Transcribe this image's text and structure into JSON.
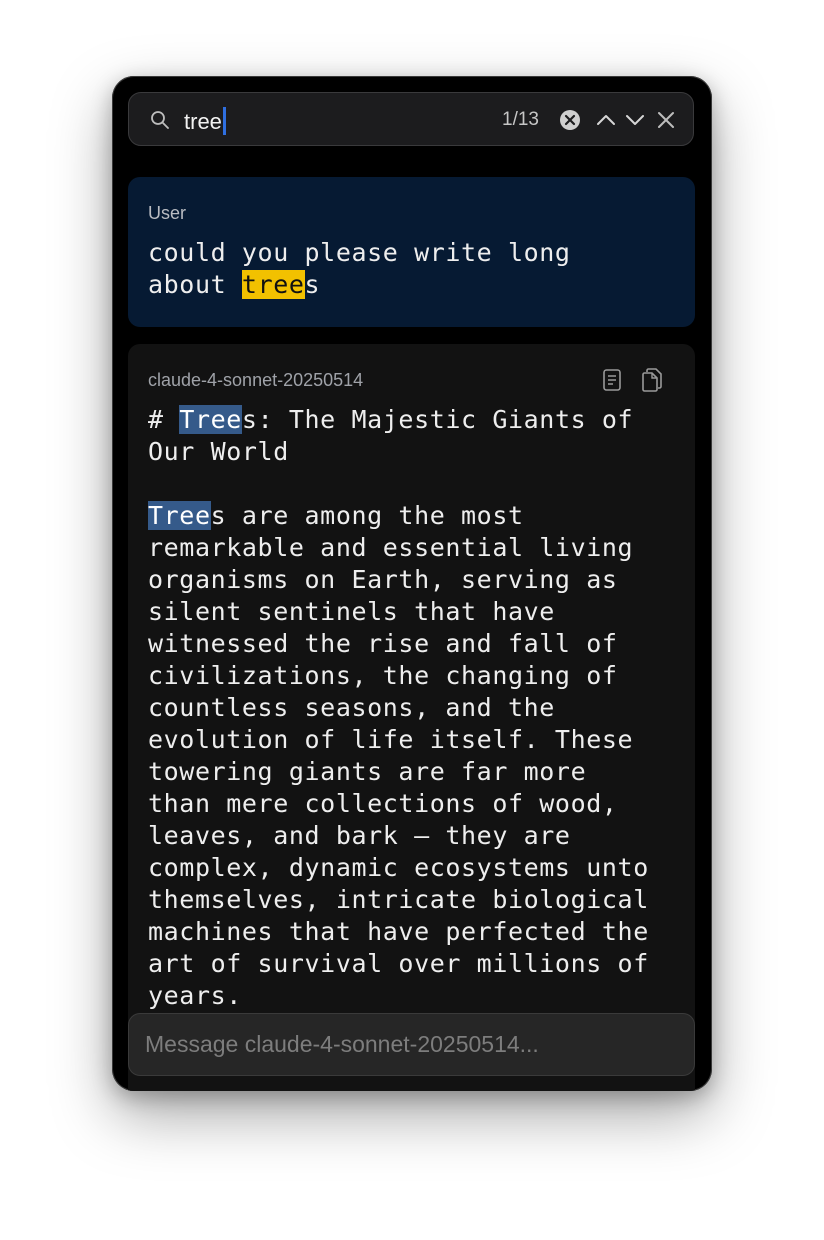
{
  "search": {
    "query": "tree",
    "match_count": "1/13"
  },
  "user_message": {
    "role_label": "User",
    "line1": "could you please write long",
    "line2_before": "about ",
    "line2_match": "tree",
    "line2_after": "s"
  },
  "assistant_message": {
    "model_label": "claude-4-sonnet-20250514",
    "heading_prefix": "# ",
    "heading_match": "Tree",
    "heading_rest": "s: The Majestic Giants of\nOur World",
    "body_match": "Tree",
    "body_rest": "s are among the most\nremarkable and essential living\norganisms on Earth, serving as\nsilent sentinels that have\nwitnessed the rise and fall of\ncivilizations, the changing of\ncountless seasons, and the\nevolution of life itself. These\ntowering giants are far more\nthan mere collections of wood,\nleaves, and bark — they are\ncomplex, dynamic ecosystems unto\nthemselves, intricate biological\nmachines that have perfected the\nart of survival over millions of\nyears."
  },
  "composer": {
    "placeholder": "Message claude-4-sonnet-20250514..."
  },
  "icons": [
    "search-icon",
    "clear-icon",
    "chevron-up-icon",
    "chevron-down-icon",
    "close-icon",
    "document-icon",
    "copy-icon"
  ],
  "colors": {
    "current_match": "#f2c100",
    "other_match": "#355a8a",
    "user_bubble": "#061a33",
    "caret": "#2f6fe0"
  }
}
